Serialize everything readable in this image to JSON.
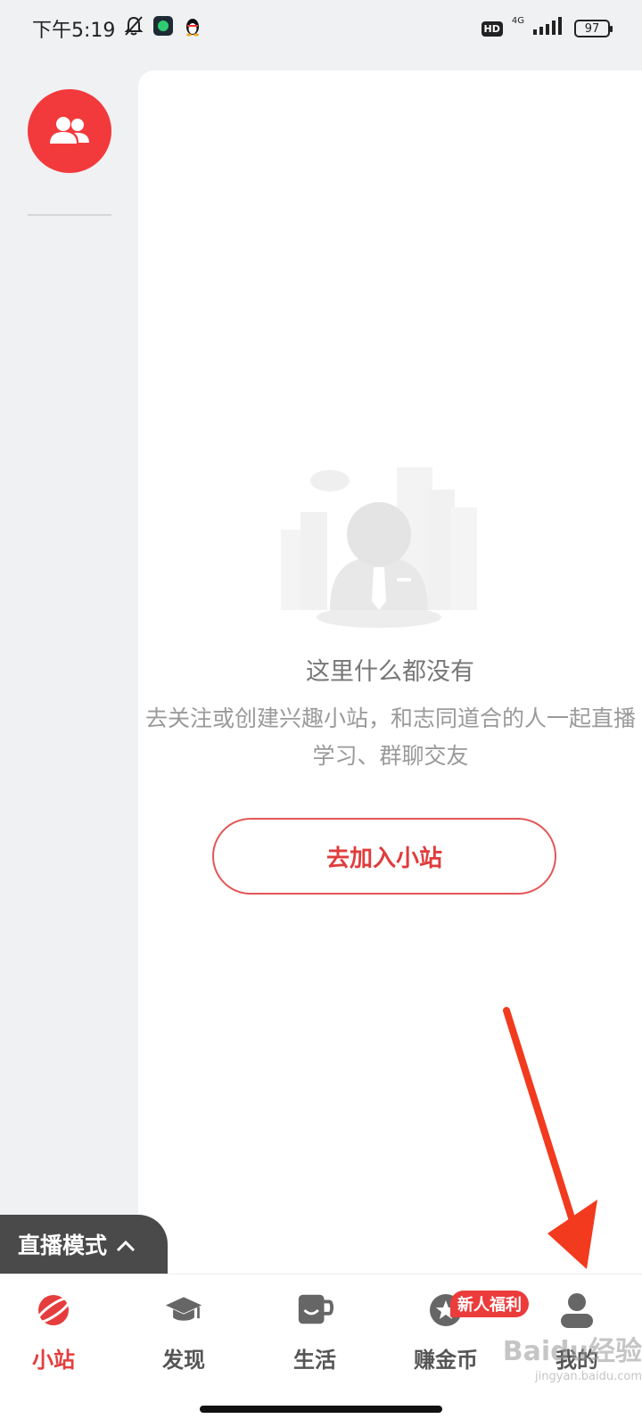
{
  "status_bar": {
    "time": "下午5:19",
    "network_label": "4G",
    "hd_label": "HD",
    "battery": "97"
  },
  "empty_state": {
    "title": "这里什么都没有",
    "description": "去关注或创建兴趣小站，和志同道合的人一起直播学习、群聊交友",
    "button_label": "去加入小站"
  },
  "live_mode": {
    "label": "直播模式"
  },
  "bottom_nav": {
    "items": [
      {
        "label": "小站",
        "icon": "planet-icon",
        "active": true
      },
      {
        "label": "发现",
        "icon": "graduation-cap-icon",
        "active": false
      },
      {
        "label": "生活",
        "icon": "cup-icon",
        "active": false
      },
      {
        "label": "赚金币",
        "icon": "coin-star-icon",
        "active": false
      },
      {
        "label": "我的",
        "icon": "person-icon",
        "active": false
      }
    ],
    "promo_badge": "新人福利"
  },
  "watermark": {
    "text": "Baidu经验",
    "url": "jingyan.baidu.com"
  },
  "colors": {
    "accent": "#f23a3c",
    "nav_inactive": "#555555",
    "rail_bg": "#f0f1f3"
  }
}
